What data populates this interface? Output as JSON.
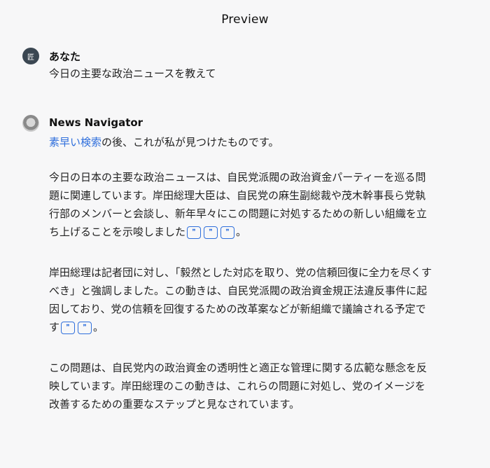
{
  "header": {
    "title": "Preview"
  },
  "user_message": {
    "avatar_glyph": "匠",
    "name": "あなた",
    "text": "今日の主要な政治ニュースを教えて"
  },
  "bot_message": {
    "name": "News Navigator",
    "link_label": "素早い検索",
    "after_link": "の後、これが私が見つけたものです。",
    "paragraphs": [
      {
        "text": "今日の日本の主要な政治ニュースは、自民党派閥の政治資金パーティーを巡る問題に関連しています。岸田総理大臣は、自民党の麻生副総裁や茂木幹事長ら党執行部のメンバーと会談し、新年早々にこの問題に対処するための新しい組織を立ち上げることを示唆しました",
        "citations": [
          "❞",
          "❞",
          "❞"
        ],
        "end": "。"
      },
      {
        "text": "岸田総理は記者団に対し、「毅然とした対応を取り、党の信頼回復に全力を尽くすべき」と強調しました。この動きは、自民党派閥の政治資金規正法違反事件に起因しており、党の信頼を回復するための改革案などが新組織で議論される予定です",
        "citations": [
          "❞",
          "❞"
        ],
        "end": "。"
      },
      {
        "text": "この問題は、自民党内の政治資金の透明性と適正な管理に関する広範な懸念を反映しています。岸田総理のこの動きは、これらの問題に対処し、党のイメージを改善するための重要なステップと見なされています。",
        "citations": [],
        "end": ""
      }
    ]
  },
  "colors": {
    "background": "#f7f7f8",
    "link": "#2f6fdc",
    "user_avatar": "#3b4752"
  },
  "icons": {
    "user_avatar": "user-avatar-icon",
    "bot_avatar": "robot-avatar-icon",
    "citation": "citation-quote-icon"
  }
}
